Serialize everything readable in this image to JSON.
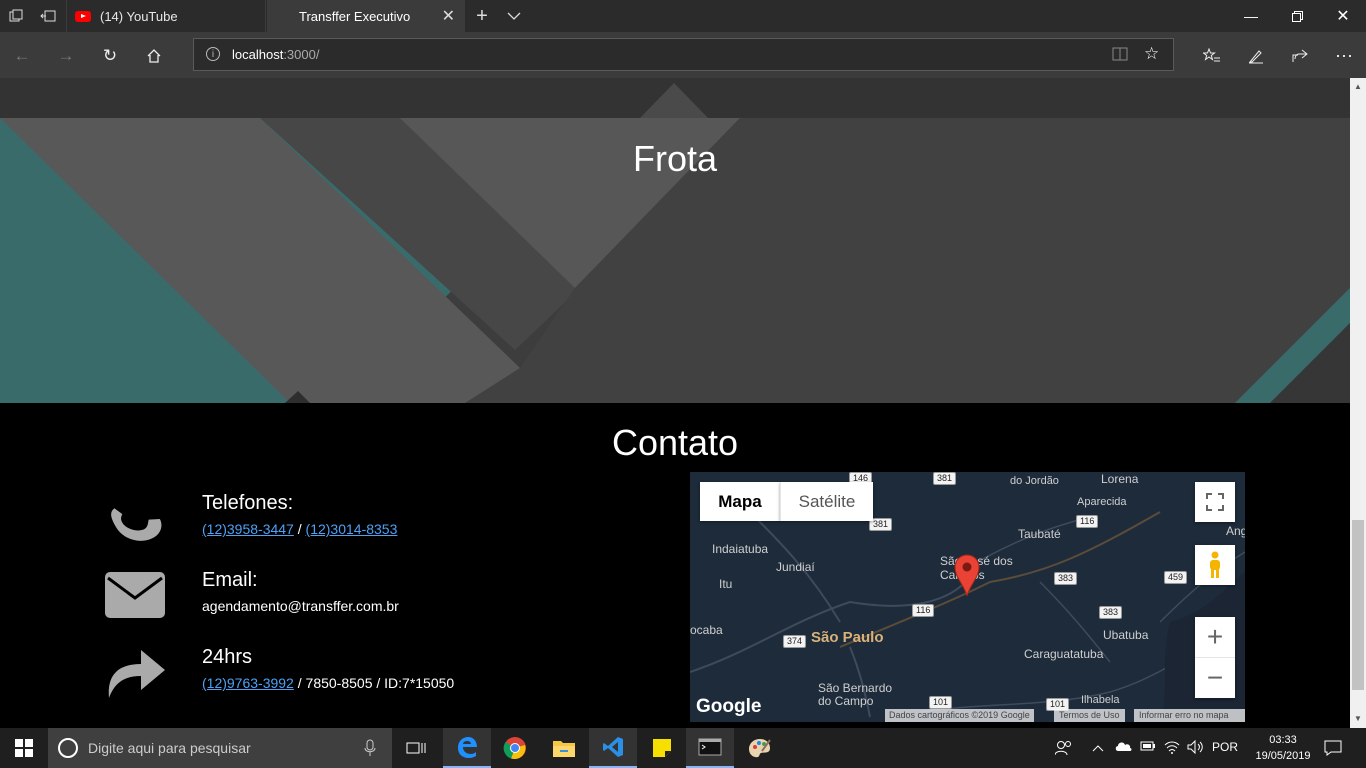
{
  "browser": {
    "tabs": [
      {
        "label": "(14) YouTube"
      },
      {
        "label": "Transffer Executivo"
      }
    ],
    "address": {
      "host": "localhost",
      "rest": ":3000/"
    }
  },
  "page": {
    "frota_title": "Frota",
    "contato_title": "Contato",
    "contacts": {
      "telefones": {
        "title": "Telefones:",
        "phone1": "(12)3958-3447",
        "sep": " / ",
        "phone2": "(12)3014-8353"
      },
      "email": {
        "title": "Email:",
        "address": "agendamento@transffer.com.br"
      },
      "h24": {
        "title": "24hrs",
        "phone": "(12)9763-3992",
        "rest": " / 7850-8505 / ID:7*15050"
      }
    },
    "map": {
      "tab_map": "Mapa",
      "tab_satellite": "Satélite",
      "places": [
        "Indaiatuba",
        "Jundiaí",
        "Itu",
        "ocaba",
        "São Paulo",
        "São Bernardo do Campo",
        "São José dos Campos",
        "Taubaté",
        "Lorena",
        "Aparecida",
        "Ubatuba",
        "Caraguatatuba",
        "Ilhabela",
        "do Jordão",
        "Ang"
      ],
      "roads": [
        "146",
        "381",
        "381",
        "116",
        "116",
        "383",
        "383",
        "459",
        "374",
        "101",
        "101"
      ],
      "logo": "Google",
      "footer_data": "Dados cartográficos ©2019 Google",
      "footer_terms": "Termos de Uso",
      "footer_report": "Informar erro no mapa"
    }
  },
  "taskbar": {
    "search_placeholder": "Digite aqui para pesquisar",
    "lang": "POR",
    "time": "03:33",
    "date": "19/05/2019"
  }
}
